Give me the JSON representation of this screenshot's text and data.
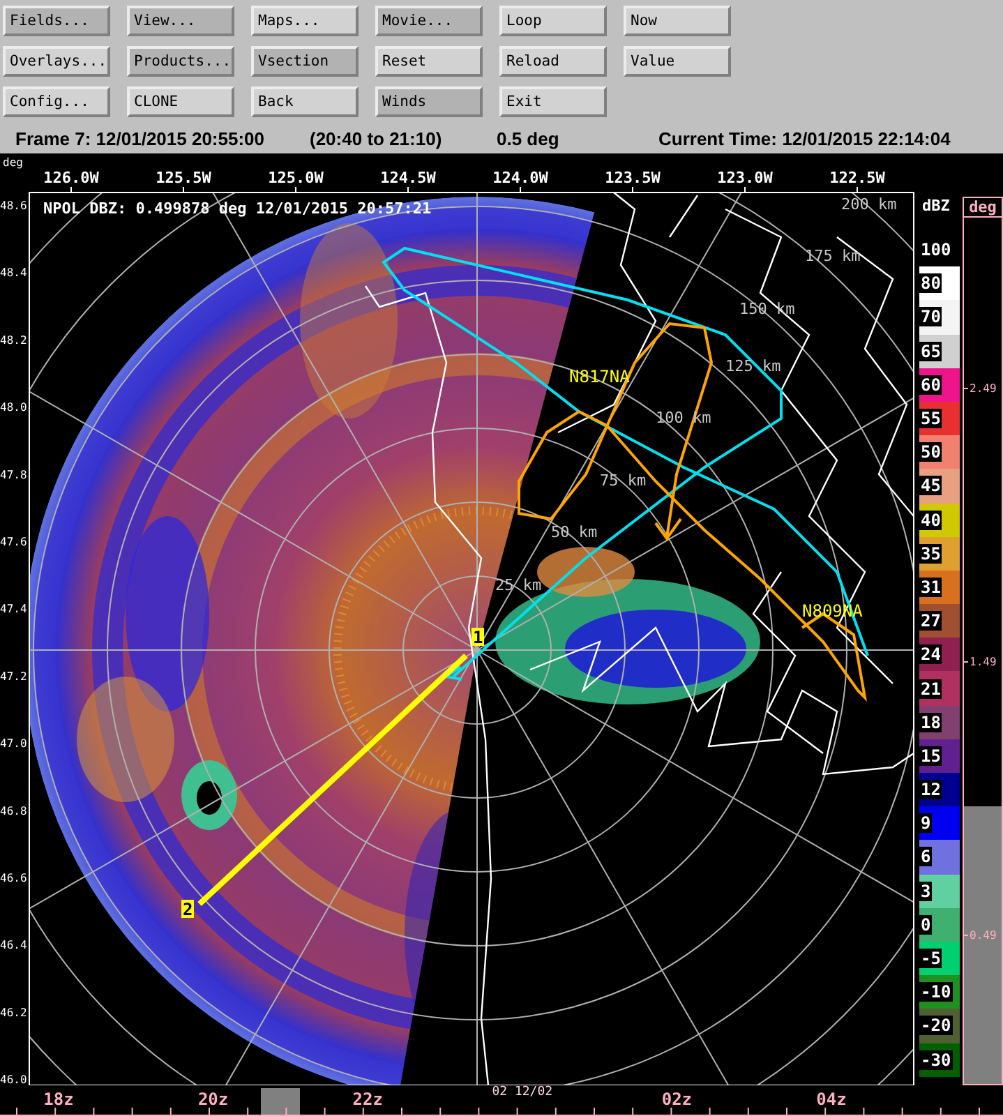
{
  "toolbar": {
    "buttons": [
      {
        "label": "Fields...",
        "active": true
      },
      {
        "label": "View...",
        "active": true
      },
      {
        "label": "Maps...",
        "active": false
      },
      {
        "label": "Movie...",
        "active": true
      },
      {
        "label": "Loop",
        "active": false
      },
      {
        "label": "Now",
        "active": false
      },
      {
        "label": "Overlays...",
        "active": false
      },
      {
        "label": "Products...",
        "active": true
      },
      {
        "label": "Vsection",
        "active": true
      },
      {
        "label": "Reset",
        "active": false
      },
      {
        "label": "Reload",
        "active": false
      },
      {
        "label": "Value",
        "active": false
      },
      {
        "label": "Config...",
        "active": false
      },
      {
        "label": "CLONE",
        "active": false
      },
      {
        "label": "Back",
        "active": false
      },
      {
        "label": "Winds",
        "active": true
      },
      {
        "label": "Exit",
        "active": false
      }
    ]
  },
  "status": {
    "frame": "Frame 7: 12/01/2015 20:55:00",
    "interval": "(20:40 to 21:10)",
    "elevation": "0.5 deg",
    "current_time": "Current Time: 12/01/2015 22:14:04"
  },
  "plot": {
    "corner_label": "deg",
    "title": "NPOL DBZ: 0.499878 deg 12/01/2015 20:57:21",
    "longitudes": [
      "126.0W",
      "125.5W",
      "125.0W",
      "124.5W",
      "124.0W",
      "123.5W",
      "123.0W",
      "122.5W"
    ],
    "latitudes": [
      "48.6",
      "48.4",
      "48.2",
      "48.0",
      "47.8",
      "47.6",
      "47.4",
      "47.2",
      "47.0",
      "46.8",
      "46.6",
      "46.4",
      "46.2",
      "46.0"
    ],
    "range_labels": [
      "25 km",
      "50 km",
      "75 km",
      "100 km",
      "125 km",
      "150 km",
      "175 km",
      "200 km"
    ],
    "aircraft": [
      {
        "label": "N817NA"
      },
      {
        "label": "N809NA"
      }
    ],
    "section_points": [
      "1",
      "2"
    ]
  },
  "legend": {
    "unit": "dBZ",
    "items": [
      {
        "label": "100",
        "color": "#000000"
      },
      {
        "label": "80",
        "color": "#ffffff"
      },
      {
        "label": "70",
        "color": "#f4f4f4"
      },
      {
        "label": "65",
        "color": "#d0d0d0"
      },
      {
        "label": "60",
        "color": "#f0148c"
      },
      {
        "label": "55",
        "color": "#e83030"
      },
      {
        "label": "50",
        "color": "#f08070"
      },
      {
        "label": "45",
        "color": "#e8a080"
      },
      {
        "label": "40",
        "color": "#d0c800"
      },
      {
        "label": "35",
        "color": "#e0a030"
      },
      {
        "label": "31",
        "color": "#d87020"
      },
      {
        "label": "27",
        "color": "#a05030"
      },
      {
        "label": "24",
        "color": "#902050"
      },
      {
        "label": "21",
        "color": "#b03060"
      },
      {
        "label": "18",
        "color": "#804070"
      },
      {
        "label": "15",
        "color": "#602090"
      },
      {
        "label": "12",
        "color": "#000090"
      },
      {
        "label": "9",
        "color": "#0000f0"
      },
      {
        "label": "6",
        "color": "#7070e0"
      },
      {
        "label": "3",
        "color": "#60d0a0"
      },
      {
        "label": "0",
        "color": "#40b070"
      },
      {
        "label": "-5",
        "color": "#00d070"
      },
      {
        "label": "-10",
        "color": "#209020"
      },
      {
        "label": "-20",
        "color": "#506030"
      },
      {
        "label": "-30",
        "color": "#006000"
      }
    ]
  },
  "elevation_bar": {
    "unit": "deg",
    "ticks": [
      "2.49",
      "1.49",
      "0.49"
    ],
    "level": 0.32
  },
  "time_axis": {
    "labels": [
      {
        "label": "18z",
        "kind": "hour"
      },
      {
        "label": "20z",
        "kind": "hour"
      },
      {
        "label": "22z",
        "kind": "hour"
      },
      {
        "label": "02 12/02",
        "kind": "date"
      },
      {
        "label": "02z",
        "kind": "hour"
      },
      {
        "label": "04z",
        "kind": "hour"
      }
    ],
    "level": 0.28
  }
}
